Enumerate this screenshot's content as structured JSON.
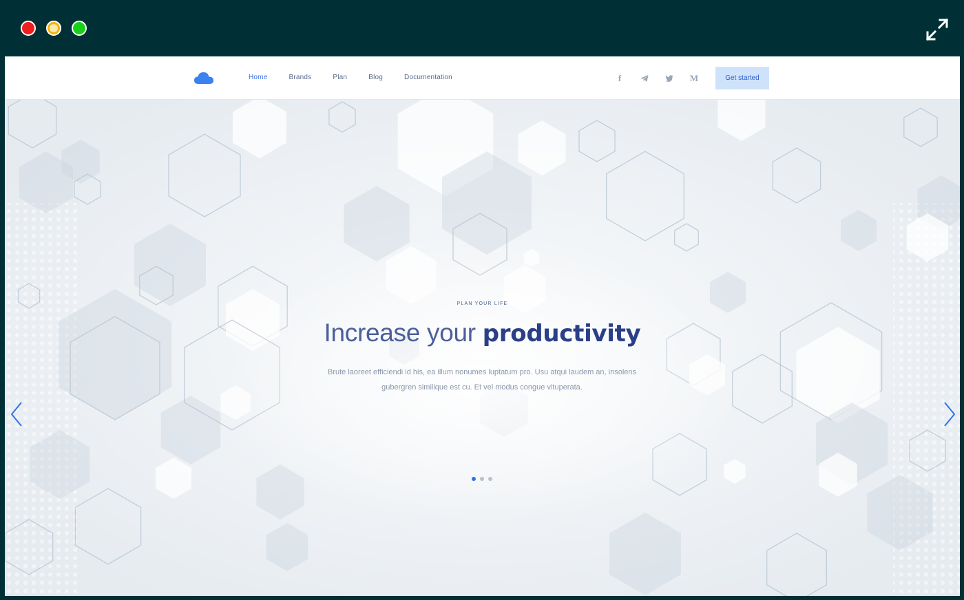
{
  "window_controls": {
    "close": "close-button",
    "minimize": "minimize-button",
    "zoom": "zoom-button",
    "expand_icon": "expand-icon"
  },
  "navbar": {
    "logo_icon": "cloud-icon",
    "menu": [
      {
        "label": "Home",
        "active": true
      },
      {
        "label": "Brands",
        "active": false
      },
      {
        "label": "Plan",
        "active": false
      },
      {
        "label": "Blog",
        "active": false
      },
      {
        "label": "Documentation",
        "active": false
      }
    ],
    "social": [
      {
        "icon": "facebook-icon",
        "glyph": "f"
      },
      {
        "icon": "telegram-icon",
        "glyph": ""
      },
      {
        "icon": "twitter-icon",
        "glyph": ""
      },
      {
        "icon": "medium-icon",
        "glyph": "M"
      }
    ],
    "cta_label": "Get started"
  },
  "hero": {
    "eyebrow": "PLAN YOUR LIFE",
    "headline_light": "Increase your ",
    "headline_bold": "productivity",
    "lead": "Brute laoreet efficiendi id his, ea illum nonumes luptatum pro. Usu atqui laudem an, insolens gubergren similique est cu. Et vel modus congue vituperata.",
    "slides_total": 3,
    "slide_active": 1
  },
  "colors": {
    "frame": "#003035",
    "accent": "#2f73e6",
    "headline": "#2a3f88",
    "cta_bg": "#cfe2fb"
  }
}
